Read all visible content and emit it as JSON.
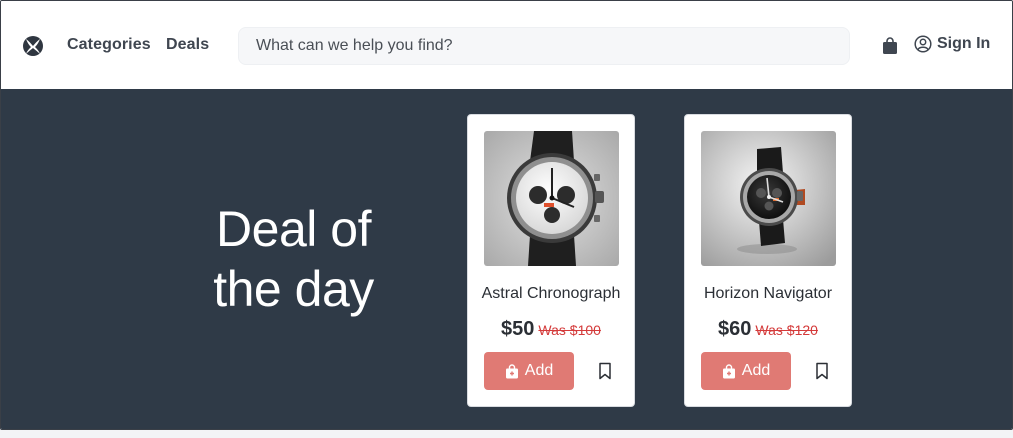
{
  "nav": {
    "logo_icon": "xbox-logo-icon",
    "links": [
      "Categories",
      "Deals"
    ],
    "search_placeholder": "What can we help you find?",
    "cart_icon": "shopping-bag-icon",
    "signin_icon": "user-circle-icon",
    "signin_label": "Sign In"
  },
  "hero": {
    "title": "Deal of the day",
    "background": "#2f3a47"
  },
  "products": [
    {
      "name": "Astral Chronograph",
      "price": "$50",
      "was": "Was $100",
      "add_label": "Add",
      "image": "watch-white-dial-image"
    },
    {
      "name": "Horizon Navigator",
      "price": "$60",
      "was": "Was $120",
      "add_label": "Add",
      "image": "watch-black-dial-image"
    }
  ],
  "colors": {
    "accent": "#e07a74",
    "strike_price": "#d43a3a",
    "text": "#3f4650"
  }
}
